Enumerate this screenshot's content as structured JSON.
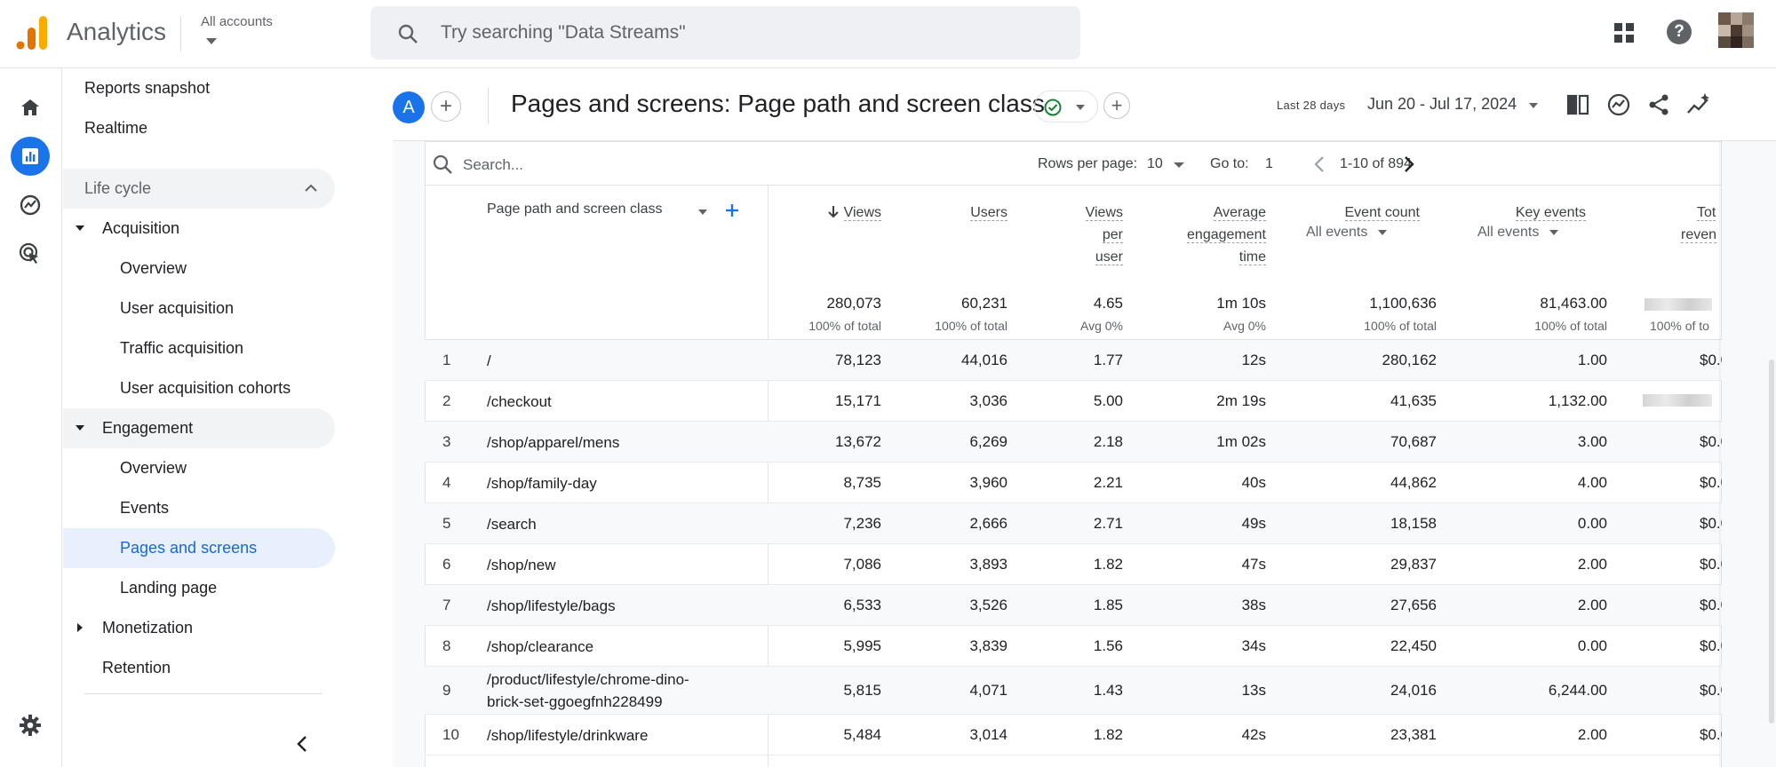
{
  "app": {
    "name": "Analytics",
    "account_label": "All accounts"
  },
  "search": {
    "placeholder": "Try searching \"Data Streams\""
  },
  "sidebar": {
    "items": [
      {
        "label": "Reports snapshot"
      },
      {
        "label": "Realtime"
      },
      {
        "label": "Life cycle"
      },
      {
        "label": "Acquisition"
      },
      {
        "label": "Overview"
      },
      {
        "label": "User acquisition"
      },
      {
        "label": "Traffic acquisition"
      },
      {
        "label": "User acquisition cohorts"
      },
      {
        "label": "Engagement"
      },
      {
        "label": "Overview"
      },
      {
        "label": "Events"
      },
      {
        "label": "Pages and screens"
      },
      {
        "label": "Landing page"
      },
      {
        "label": "Monetization"
      },
      {
        "label": "Retention"
      }
    ]
  },
  "header": {
    "comparison_letter": "A",
    "title": "Pages and screens: Page path and screen class",
    "date_label": "Last 28 days",
    "date_range": "Jun 20 - Jul 17, 2024"
  },
  "table": {
    "search_placeholder": "Search...",
    "rows_per_page_label": "Rows per page:",
    "rows_per_page": "10",
    "goto_label": "Go to:",
    "goto_value": "1",
    "page_range": "1-10 of 894",
    "dimension_header": "Page path and screen class",
    "columns": [
      {
        "name": "Views",
        "sort_icon": "arrow-down-icon",
        "total": "280,073",
        "total_sub": "100% of total"
      },
      {
        "name": "Users",
        "total": "60,231",
        "total_sub": "100% of total"
      },
      {
        "name_lines": [
          "Views",
          "per",
          "user"
        ],
        "total": "4.65",
        "total_sub": "Avg 0%"
      },
      {
        "name_lines": [
          "Average",
          "engagement",
          "time"
        ],
        "total": "1m 10s",
        "total_sub": "Avg 0%"
      },
      {
        "name": "Event count",
        "sub": "All events",
        "total": "1,100,636",
        "total_sub": "100% of total"
      },
      {
        "name": "Key events",
        "sub": "All events",
        "total": "81,463.00",
        "total_sub": "100% of total"
      },
      {
        "name_lines": [
          "Tot",
          "reven"
        ],
        "total_sub": "100% of to"
      }
    ],
    "rows": [
      {
        "idx": "1",
        "path": [
          "/"
        ],
        "views": "78,123",
        "users": "44,016",
        "vpu": "1.77",
        "aet": "12s",
        "events": "280,162",
        "key": "1.00",
        "rev": "$0.0"
      },
      {
        "idx": "2",
        "path": [
          "/checkout"
        ],
        "views": "15,171",
        "users": "3,036",
        "vpu": "5.00",
        "aet": "2m 19s",
        "events": "41,635",
        "key": "1,132.00",
        "rev": ""
      },
      {
        "idx": "3",
        "path": [
          "/shop/apparel/mens"
        ],
        "views": "13,672",
        "users": "6,269",
        "vpu": "2.18",
        "aet": "1m 02s",
        "events": "70,687",
        "key": "3.00",
        "rev": "$0.0"
      },
      {
        "idx": "4",
        "path": [
          "/shop/family-day"
        ],
        "views": "8,735",
        "users": "3,960",
        "vpu": "2.21",
        "aet": "40s",
        "events": "44,862",
        "key": "4.00",
        "rev": "$0.0"
      },
      {
        "idx": "5",
        "path": [
          "/search"
        ],
        "views": "7,236",
        "users": "2,666",
        "vpu": "2.71",
        "aet": "49s",
        "events": "18,158",
        "key": "0.00",
        "rev": "$0.0"
      },
      {
        "idx": "6",
        "path": [
          "/shop/new"
        ],
        "views": "7,086",
        "users": "3,893",
        "vpu": "1.82",
        "aet": "47s",
        "events": "29,837",
        "key": "2.00",
        "rev": "$0.0"
      },
      {
        "idx": "7",
        "path": [
          "/shop/lifestyle/bags"
        ],
        "views": "6,533",
        "users": "3,526",
        "vpu": "1.85",
        "aet": "38s",
        "events": "27,656",
        "key": "2.00",
        "rev": "$0.0"
      },
      {
        "idx": "8",
        "path": [
          "/shop/clearance"
        ],
        "views": "5,995",
        "users": "3,839",
        "vpu": "1.56",
        "aet": "34s",
        "events": "22,450",
        "key": "0.00",
        "rev": "$0.0"
      },
      {
        "idx": "9",
        "path": [
          "/product/lifestyle/chrome-dino-",
          "brick-set-ggoegfnh228499"
        ],
        "views": "5,815",
        "users": "4,071",
        "vpu": "1.43",
        "aet": "13s",
        "events": "24,016",
        "key": "6,244.00",
        "rev": "$0.0"
      },
      {
        "idx": "10",
        "path": [
          "/shop/lifestyle/drinkware"
        ],
        "views": "5,484",
        "users": "3,014",
        "vpu": "1.82",
        "aet": "42s",
        "events": "23,381",
        "key": "2.00",
        "rev": "$0.0"
      }
    ]
  },
  "colors": {
    "accent": "#1a73e8",
    "selected_bg": "#e8f0fe",
    "selected_text": "#1967d2",
    "logo_orange": "#f9ab00",
    "logo_dark_orange": "#e37400",
    "status_green": "#188038"
  }
}
